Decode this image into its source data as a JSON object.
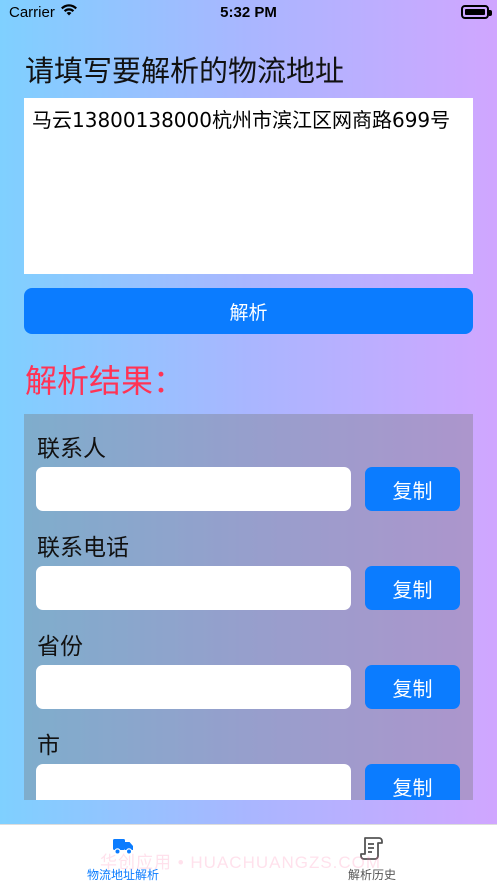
{
  "status": {
    "carrier": "Carrier",
    "time": "5:32 PM"
  },
  "prompt_title": "请填写要解析的物流地址",
  "address_value": "马云13800138000杭州市滨江区网商路699号",
  "parse_button": "解析",
  "result_title": "解析结果：",
  "fields": [
    {
      "label": "联系人",
      "value": "",
      "copy": "复制"
    },
    {
      "label": "联系电话",
      "value": "",
      "copy": "复制"
    },
    {
      "label": "省份",
      "value": "",
      "copy": "复制"
    },
    {
      "label": "市",
      "value": "",
      "copy": "复制"
    }
  ],
  "tabs": [
    {
      "label": "物流地址解析",
      "icon": "truck-icon",
      "active": true
    },
    {
      "label": "解析历史",
      "icon": "history-scroll-icon",
      "active": false
    }
  ],
  "watermark": "华创应用 • HUACHUANGZS.COM",
  "colors": {
    "accent": "#0b7cff",
    "result_title": "#ff3355",
    "tab_inactive": "#555555"
  }
}
